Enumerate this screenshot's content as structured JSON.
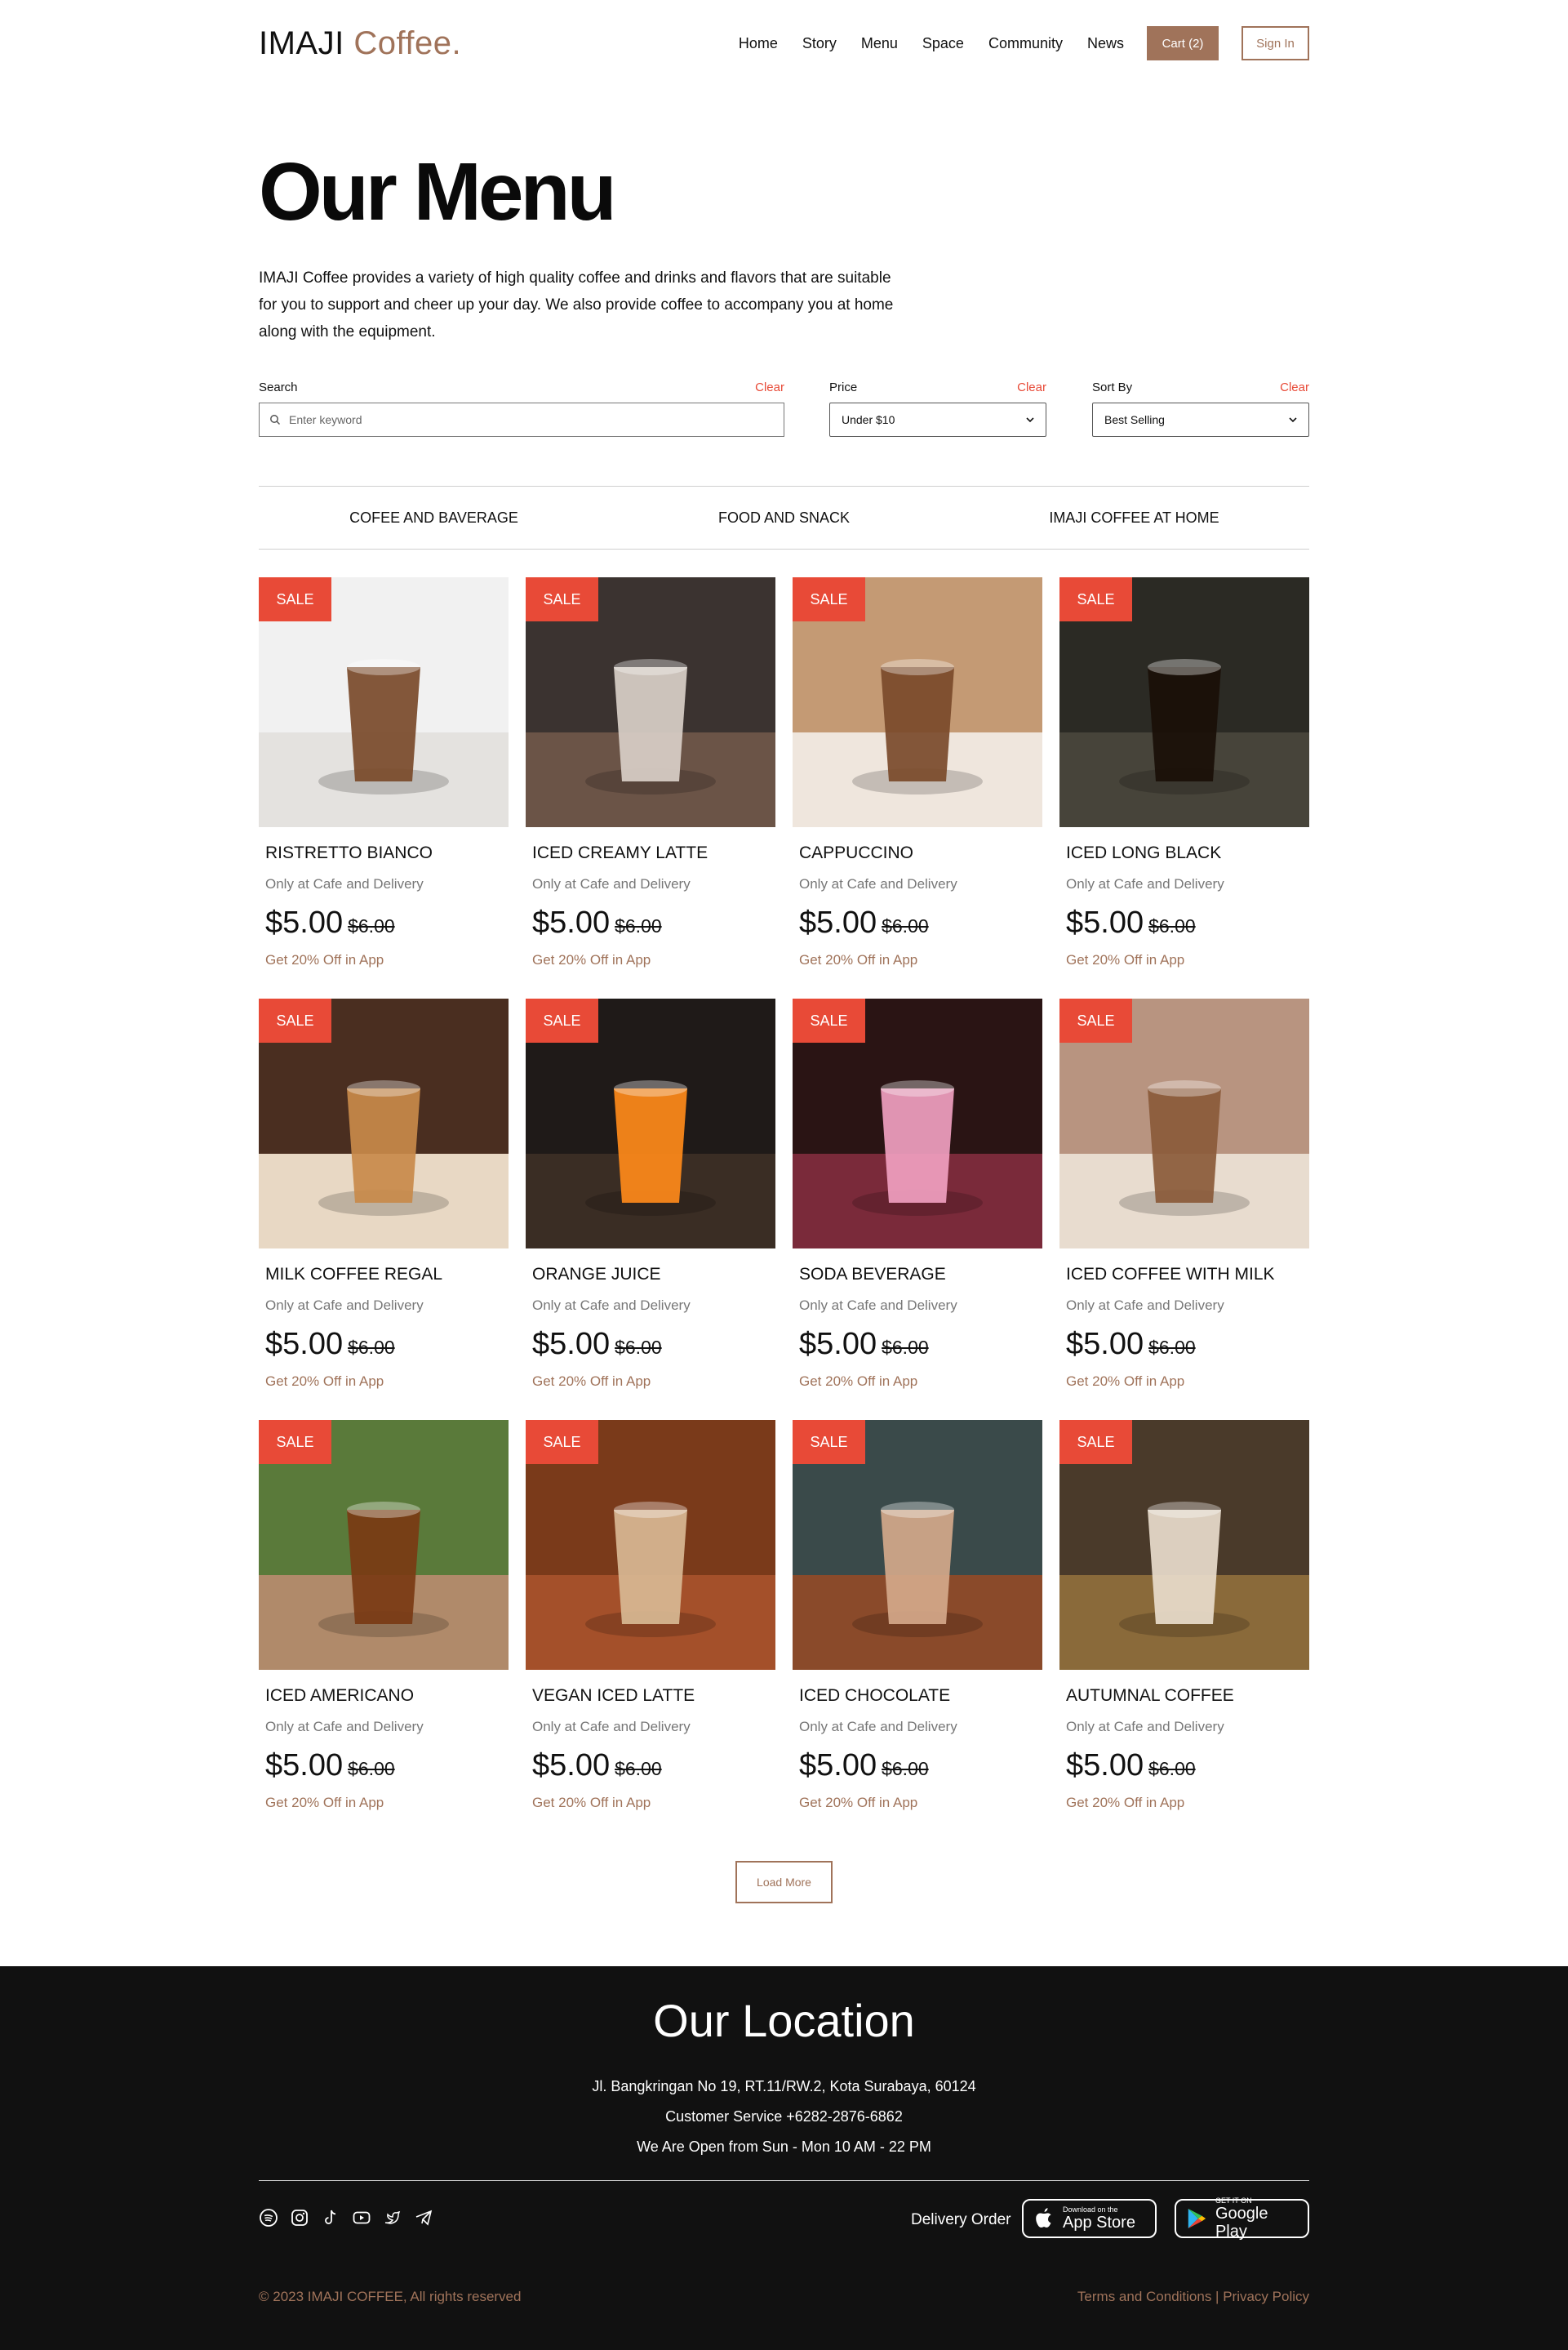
{
  "header": {
    "logo_main": "IMAJI",
    "logo_accent": "Coffee.",
    "nav": [
      "Home",
      "Story",
      "Menu",
      "Space",
      "Community",
      "News"
    ],
    "cart_label": "Cart (2)",
    "signin_label": "Sign In"
  },
  "hero": {
    "title": "Our Menu",
    "description": "IMAJI Coffee provides a variety of high quality coffee and drinks and flavors that are suitable for you to support and cheer up your day. We also provide coffee to accompany you at home along with the equipment."
  },
  "filters": {
    "search_label": "Search",
    "search_placeholder": "Enter keyword",
    "price_label": "Price",
    "price_value": "Under $10",
    "sort_label": "Sort By",
    "sort_value": "Best Selling",
    "clear_label": "Clear"
  },
  "categories": [
    "COFEE AND BAVERAGE",
    "FOOD AND SNACK",
    "IMAJI COFFEE AT HOME"
  ],
  "product_common": {
    "sale_label": "SALE",
    "subtitle": "Only at Cafe and Delivery",
    "price": "$5.00",
    "old_price": "$6.00",
    "offer": "Get 20% Off in App"
  },
  "products": [
    {
      "name": "RISTRETTO BIANCO",
      "colors": [
        "#f1f1f1",
        "#e4e2df",
        "#7a4a2a"
      ]
    },
    {
      "name": "ICED CREAMY LATTE",
      "colors": [
        "#3b3330",
        "#6b5447",
        "#d9cfc8"
      ]
    },
    {
      "name": "CAPPUCCINO",
      "colors": [
        "#c49a74",
        "#efe6dd",
        "#7a4a2a"
      ]
    },
    {
      "name": "ICED LONG BLACK",
      "colors": [
        "#2b2a24",
        "#47443a",
        "#1a0f08"
      ]
    },
    {
      "name": "MILK COFFEE REGAL",
      "colors": [
        "#4a2e20",
        "#e8d8c4",
        "#c88a4a"
      ]
    },
    {
      "name": "ORANGE JUICE",
      "colors": [
        "#1f1a18",
        "#3a2d24",
        "#ff8a1a"
      ]
    },
    {
      "name": "SODA BEVERAGE",
      "colors": [
        "#2a1414",
        "#7a2a3a",
        "#f0a0c0"
      ]
    },
    {
      "name": "ICED COFFEE WITH MILK",
      "colors": [
        "#b89480",
        "#e8dccf",
        "#8a5a3a"
      ]
    },
    {
      "name": "ICED AMERICANO",
      "colors": [
        "#5a7a3a",
        "#b08a6a",
        "#7a3a14"
      ]
    },
    {
      "name": "VEGAN ICED LATTE",
      "colors": [
        "#7a3a1a",
        "#a4502a",
        "#d8b894"
      ]
    },
    {
      "name": "ICED CHOCOLATE",
      "colors": [
        "#3a4a4a",
        "#8a4a2a",
        "#d4a88a"
      ]
    },
    {
      "name": "AUTUMNAL COFFEE",
      "colors": [
        "#4a3a2a",
        "#8a6a3a",
        "#e8dccc"
      ]
    }
  ],
  "load_more_label": "Load More",
  "footer": {
    "title": "Our Location",
    "address": "Jl. Bangkringan No 19, RT.11/RW.2, Kota Surabaya, 60124",
    "service": "Customer Service +6282-2876-6862",
    "hours": "We Are Open from Sun - Mon 10 AM - 22 PM",
    "delivery_label": "Delivery Order",
    "appstore_small": "Download on the",
    "appstore_big": "App Store",
    "googleplay_small": "GET IT ON",
    "googleplay_big": "Google Play",
    "copyright": "© 2023 IMAJI COFFEE, All rights reserved",
    "terms": "Terms and Conditions | Privacy Policy",
    "social_icons": [
      "spotify-icon",
      "instagram-icon",
      "tiktok-icon",
      "youtube-icon",
      "twitter-icon",
      "telegram-icon"
    ]
  }
}
